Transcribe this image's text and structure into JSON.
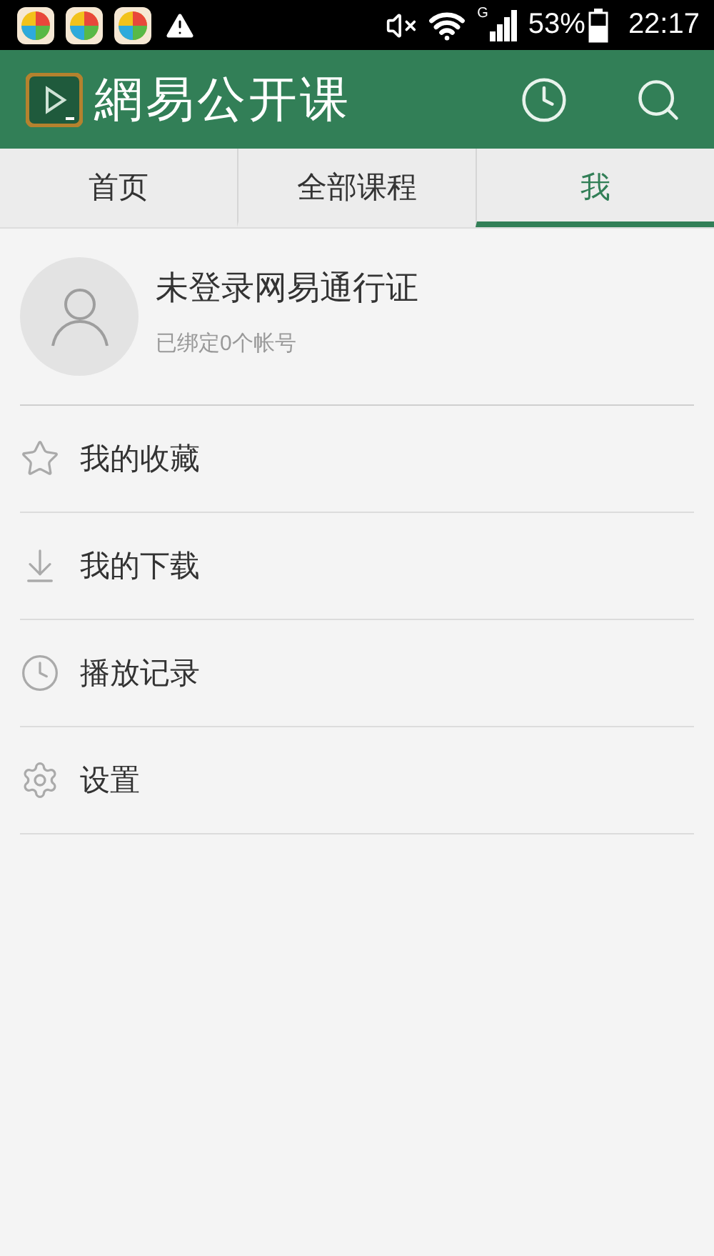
{
  "status_bar": {
    "network": "G",
    "battery": "53%",
    "time": "22:17"
  },
  "app_bar": {
    "title": "網易公开课"
  },
  "tabs": [
    {
      "label": "首页",
      "selected": false
    },
    {
      "label": "全部课程",
      "selected": false
    },
    {
      "label": "我",
      "selected": true
    }
  ],
  "profile": {
    "name": "未登录网易通行证",
    "subtitle": "已绑定0个帐号"
  },
  "menu": [
    {
      "kind": "star",
      "label": "我的收藏"
    },
    {
      "kind": "download",
      "label": "我的下载"
    },
    {
      "kind": "clock",
      "label": "播放记录"
    },
    {
      "kind": "gear",
      "label": "设置"
    }
  ]
}
